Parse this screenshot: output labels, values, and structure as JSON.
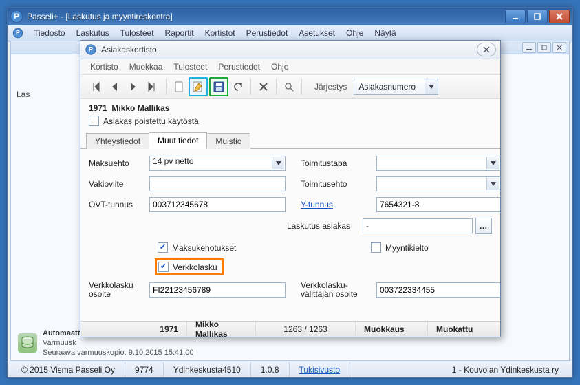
{
  "outer": {
    "title": "Passeli+ - [Laskutus ja myyntireskontra]",
    "menu": [
      "Tiedosto",
      "Laskutus",
      "Tulosteet",
      "Raportit",
      "Kortistot",
      "Perustiedot",
      "Asetukset",
      "Ohje",
      "Näytä"
    ],
    "side_label": "Las"
  },
  "backup": {
    "title": "Automaatt",
    "line1": "Varmuusk",
    "line2": "Seuraava varmuuskopio: 9.10.2015 15:41:00"
  },
  "status": {
    "copyright": "© 2015 Visma Passeli Oy",
    "code": "9774",
    "unit": "Ydinkeskusta4510",
    "version": "1.0.8",
    "support": "Tukisivusto",
    "org": "1 - Kouvolan Ydinkeskusta ry"
  },
  "dialog": {
    "title": "Asiakaskortisto",
    "menu": [
      "Kortisto",
      "Muokkaa",
      "Tulosteet",
      "Perustiedot",
      "Ohje"
    ],
    "sort_label": "Järjestys",
    "sort_value": "Asiakasnumero",
    "customer_id": "1971",
    "customer_name": "Mikko Mallikas",
    "deleted_label": "Asiakas poistettu käytöstä",
    "tabs": [
      "Yhteystiedot",
      "Muut tiedot",
      "Muistio"
    ],
    "active_tab": 1,
    "fields": {
      "maksuehto_label": "Maksuehto",
      "maksuehto_value": "14 pv netto",
      "toimitustapa_label": "Toimitustapa",
      "toimitustapa_value": "",
      "vakioviite_label": "Vakioviite",
      "vakioviite_value": "",
      "toimitusehto_label": "Toimitusehto",
      "toimitusehto_value": "",
      "ovt_label": "OVT-tunnus",
      "ovt_value": "003712345678",
      "ytunnus_label": "Y-tunnus",
      "ytunnus_value": "7654321-8",
      "laskutus_label": "Laskutus asiakas",
      "laskutus_value": "-",
      "maksukehotukset_label": "Maksukehotukset",
      "myyntikielto_label": "Myyntikielto",
      "verkkolasku_label": "Verkkolasku",
      "verkkolasku_osoite_label": "Verkkolasku osoite",
      "verkkolasku_osoite_value": "FI22123456789",
      "valittaja_label": "Verkkolasku-välittäjän osoite",
      "valittaja_value": "003722334455"
    },
    "status": {
      "id": "1971",
      "name": "Mikko Mallikas",
      "counter": "1263 / 1263",
      "mode": "Muokkaus",
      "changed": "Muokattu"
    }
  }
}
